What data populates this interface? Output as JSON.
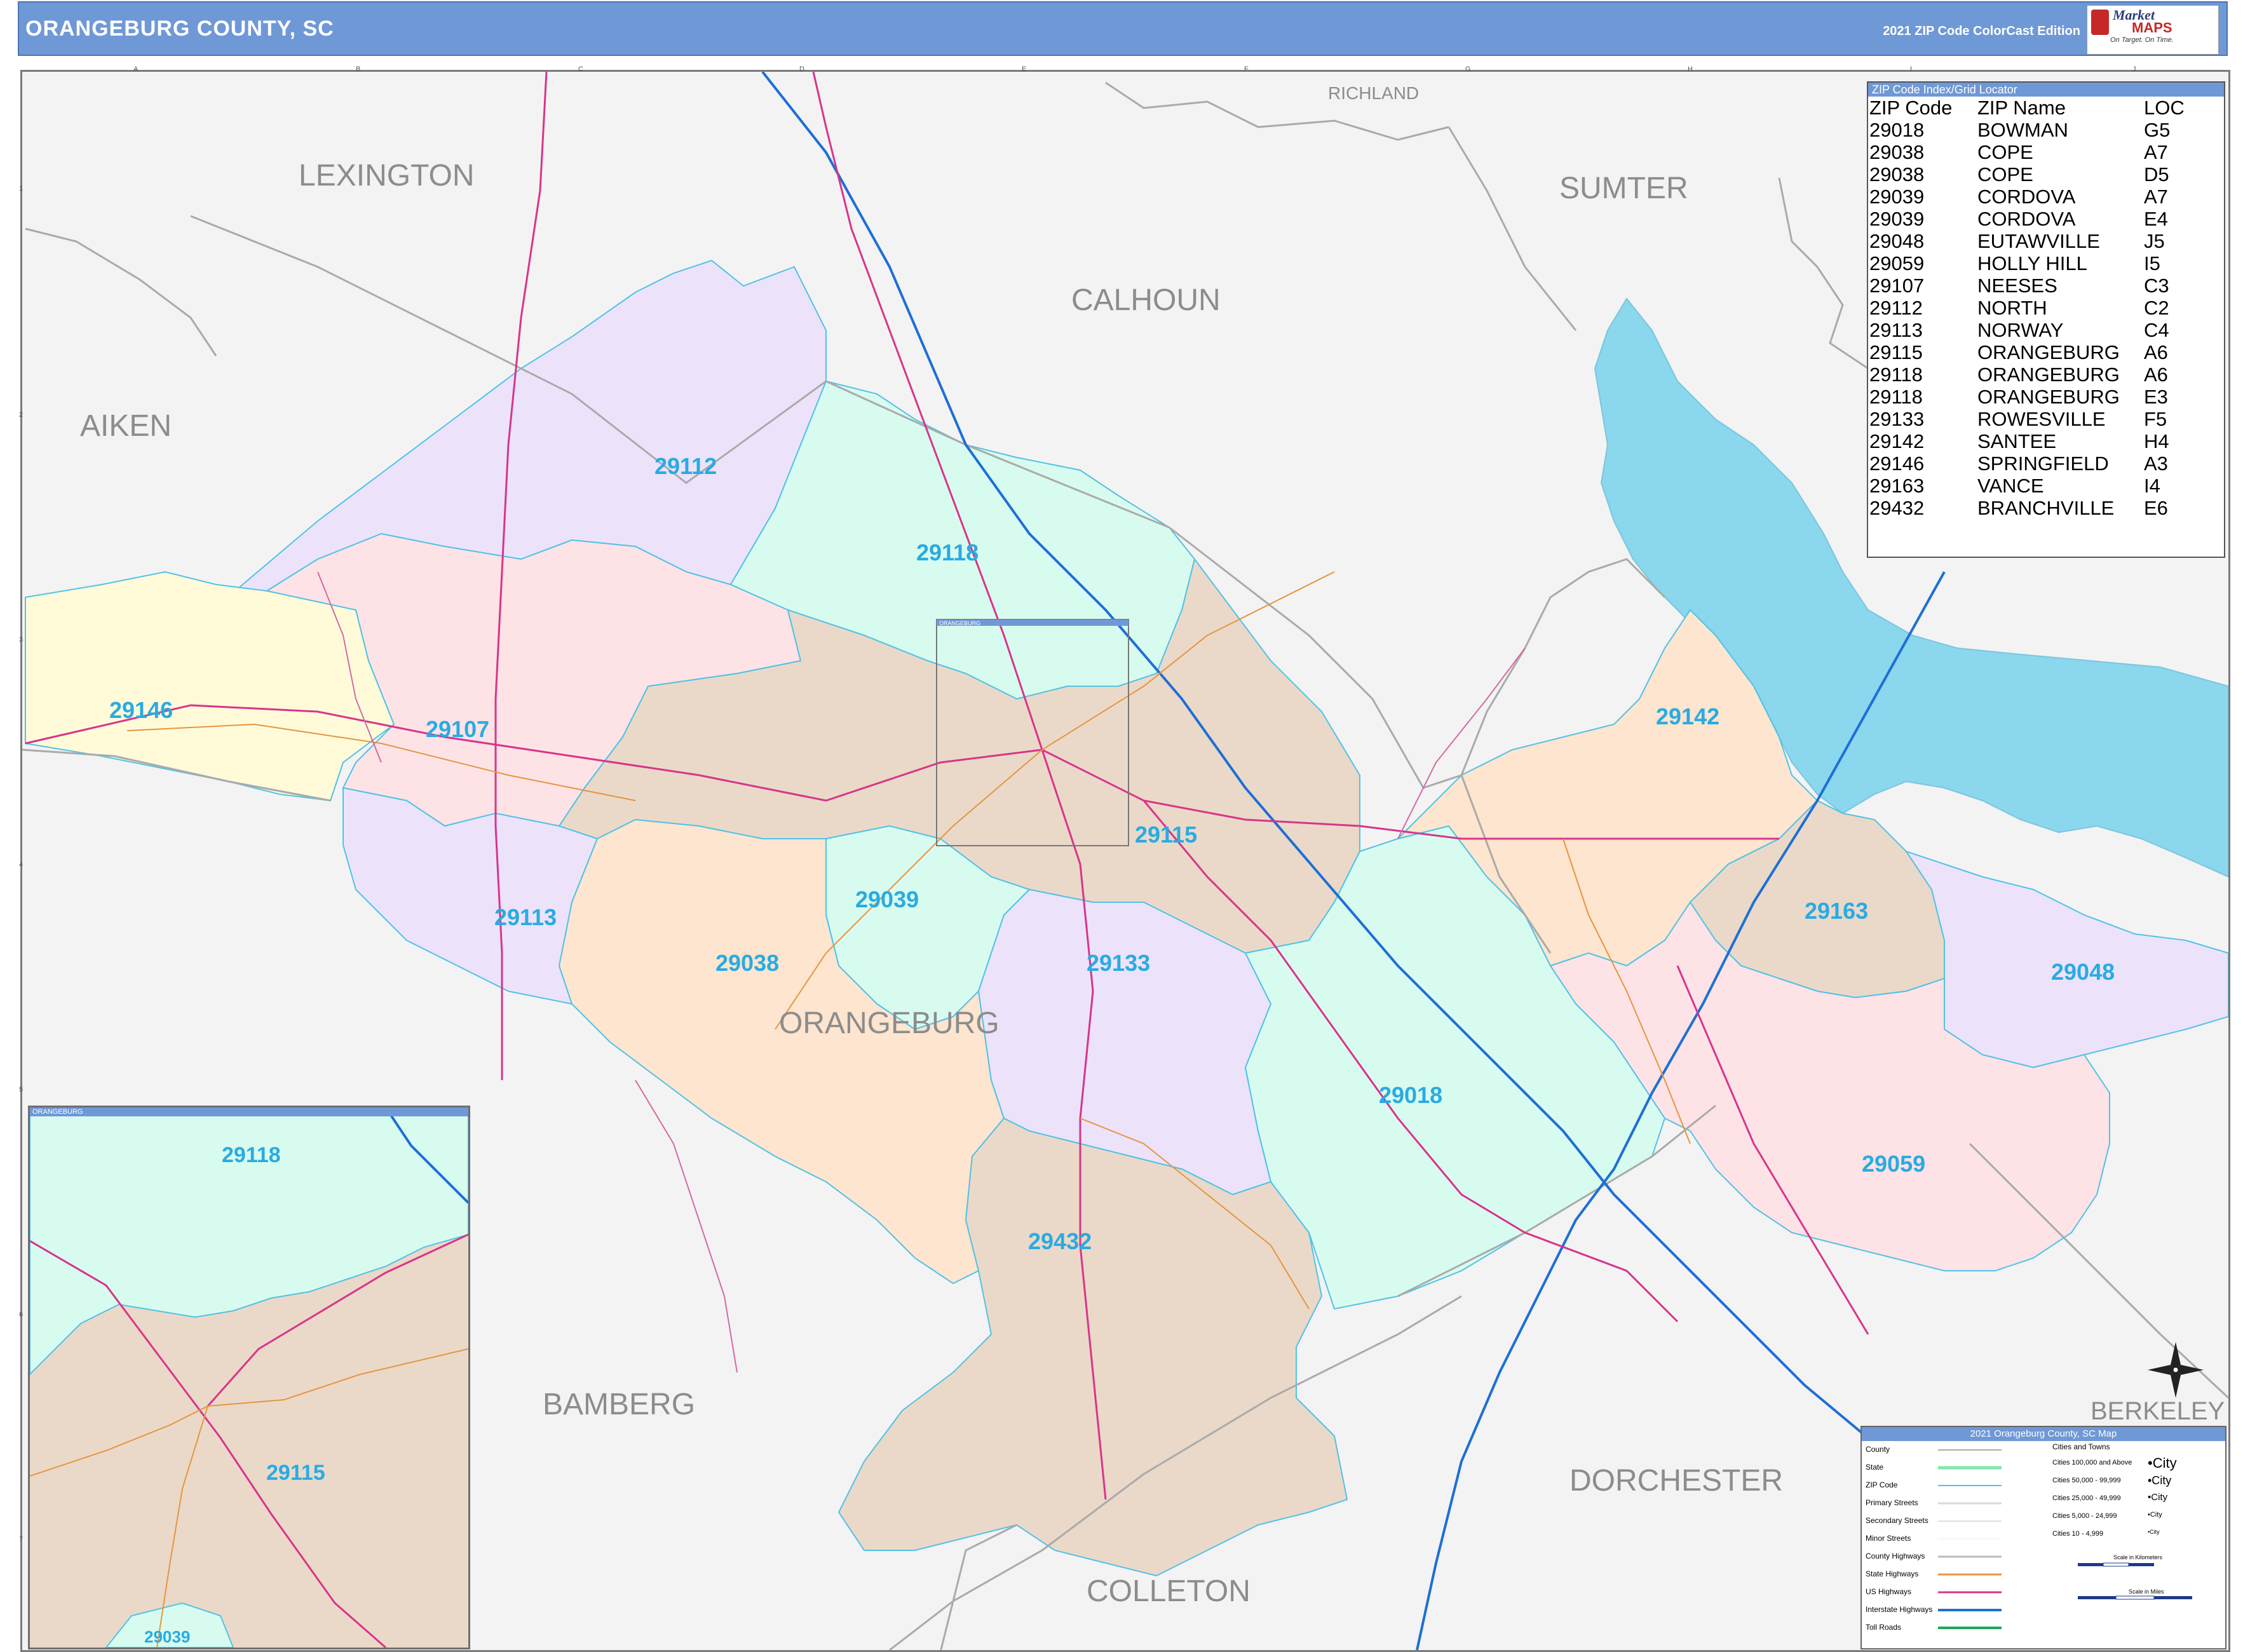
{
  "header": {
    "title": "ORANGEBURG COUNTY, SC",
    "edition": "2021 ZIP Code ColorCast Edition",
    "logo_name": "Market",
    "logo_maps": "MAPS",
    "logo_tagline": "On Target. On Time."
  },
  "counties": {
    "lexington": "LEXINGTON",
    "richland": "RICHLAND",
    "sumter": "SUMTER",
    "calhoun": "CALHOUN",
    "aiken": "AIKEN",
    "orangeburg": "ORANGEBURG",
    "bamberg": "BAMBERG",
    "dorchester": "DORCHESTER",
    "colleton": "COLLETON",
    "berkeley": "BERKELEY"
  },
  "zip_labels": {
    "z29112": "29112",
    "z29118": "29118",
    "z29146": "29146",
    "z29107": "29107",
    "z29115": "29115",
    "z29142": "29142",
    "z29039": "29039",
    "z29113": "29113",
    "z29038": "29038",
    "z29133": "29133",
    "z29163": "29163",
    "z29048": "29048",
    "z29018": "29018",
    "z29059": "29059",
    "z29432": "29432"
  },
  "zip_colors": {
    "purple": "#ece3fb",
    "pink": "#fde3e6",
    "yellow": "#fffbd9",
    "green": "#d8fbef",
    "tan": "#ead9c9",
    "peach": "#fde5cf",
    "outside": "#f3f3f3",
    "water": "#8ad7ee",
    "zip_label": "#29abe2"
  },
  "index": {
    "title": "ZIP Code Index/Grid Locator",
    "header": {
      "zip": "ZIP Code",
      "name": "ZIP Name",
      "loc": "LOC"
    },
    "rows": [
      {
        "zip": "29018",
        "name": "BOWMAN",
        "loc": "G5"
      },
      {
        "zip": "29038",
        "name": "COPE",
        "loc": "A7"
      },
      {
        "zip": "29038",
        "name": "COPE",
        "loc": "D5"
      },
      {
        "zip": "29039",
        "name": "CORDOVA",
        "loc": "A7"
      },
      {
        "zip": "29039",
        "name": "CORDOVA",
        "loc": "E4"
      },
      {
        "zip": "29048",
        "name": "EUTAWVILLE",
        "loc": "J5"
      },
      {
        "zip": "29059",
        "name": "HOLLY HILL",
        "loc": "I5"
      },
      {
        "zip": "29107",
        "name": "NEESES",
        "loc": "C3"
      },
      {
        "zip": "29112",
        "name": "NORTH",
        "loc": "C2"
      },
      {
        "zip": "29113",
        "name": "NORWAY",
        "loc": "C4"
      },
      {
        "zip": "29115",
        "name": "ORANGEBURG",
        "loc": "A6"
      },
      {
        "zip": "29118",
        "name": "ORANGEBURG",
        "loc": "A6"
      },
      {
        "zip": "29118",
        "name": "ORANGEBURG",
        "loc": "E3"
      },
      {
        "zip": "29133",
        "name": "ROWESVILLE",
        "loc": "F5"
      },
      {
        "zip": "29142",
        "name": "SANTEE",
        "loc": "H4"
      },
      {
        "zip": "29146",
        "name": "SPRINGFIELD",
        "loc": "A3"
      },
      {
        "zip": "29163",
        "name": "VANCE",
        "loc": "I4"
      },
      {
        "zip": "29432",
        "name": "BRANCHVILLE",
        "loc": "E6"
      }
    ]
  },
  "inset": {
    "title": "ORANGEBURG",
    "z29118": "29118",
    "z29115": "29115",
    "z29039": "29039"
  },
  "small_labels": {
    "orangeburg_box": "ORANGEBURG"
  },
  "grid": {
    "cols": [
      "A",
      "B",
      "C",
      "D",
      "E",
      "F",
      "G",
      "H",
      "I",
      "J"
    ],
    "rows": [
      "1",
      "2",
      "3",
      "4",
      "5",
      "6",
      "7"
    ]
  },
  "legend": {
    "title": "2021 Orangeburg County, SC Map",
    "left_items": [
      "County",
      "State",
      "ZIP Code",
      "Primary Streets",
      "Secondary Streets",
      "Minor Streets",
      "County Highways",
      "State Highways",
      "US Highways",
      "Interstate Highways",
      "Toll Roads"
    ],
    "cities_title": "Cities and Towns",
    "cities": [
      {
        "range": "Cities 100,000 and Above",
        "sample": "•City"
      },
      {
        "range": "Cities 50,000 - 99,999",
        "sample": "•City"
      },
      {
        "range": "Cities 25,000 - 49,999",
        "sample": "•City"
      },
      {
        "range": "Cities 5,000 - 24,999",
        "sample": "•City"
      },
      {
        "range": "Cities 10 - 4,999",
        "sample": "•City"
      }
    ],
    "scale_km": "Scale in Kilometers",
    "scale_mi": "Scale in Miles"
  }
}
